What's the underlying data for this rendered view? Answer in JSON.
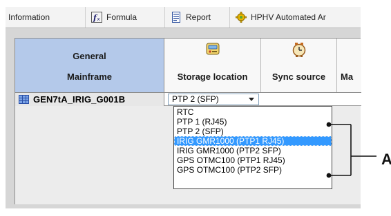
{
  "tabs": [
    {
      "label": "Information",
      "icon": "none"
    },
    {
      "label": "Formula",
      "icon": "formula-icon"
    },
    {
      "label": "Report",
      "icon": "report-icon"
    },
    {
      "label": "HPHV Automated Ar",
      "icon": "gear-icon"
    }
  ],
  "header": {
    "general_line1": "General",
    "general_line2": "Mainframe",
    "columns": [
      {
        "label": "Storage location",
        "icon": "storage-location-icon"
      },
      {
        "label": "Sync source",
        "icon": "sync-clock-icon"
      },
      {
        "label": "Ma"
      }
    ]
  },
  "row": {
    "name": "GEN7tA_IRIG_G001B",
    "storage_location": "PTP 2 (SFP)"
  },
  "dropdown": {
    "options": [
      "RTC",
      "PTP 1 (RJ45)",
      "PTP 2 (SFP)",
      "IRIG GMR1000 (PTP1 RJ45)",
      "IRIG GMR1000 (PTP2 SFP)",
      "GPS OTMC100 (PTP1 RJ45)",
      "GPS OTMC100 (PTP2 SFP)"
    ],
    "highlighted": "IRIG GMR1000 (PTP1 RJ45)"
  },
  "callout": {
    "label": "A"
  },
  "colors": {
    "header_general_bg": "#b4c9ea",
    "selection": "#3399ff",
    "panel_bg": "#d6d6d6"
  }
}
